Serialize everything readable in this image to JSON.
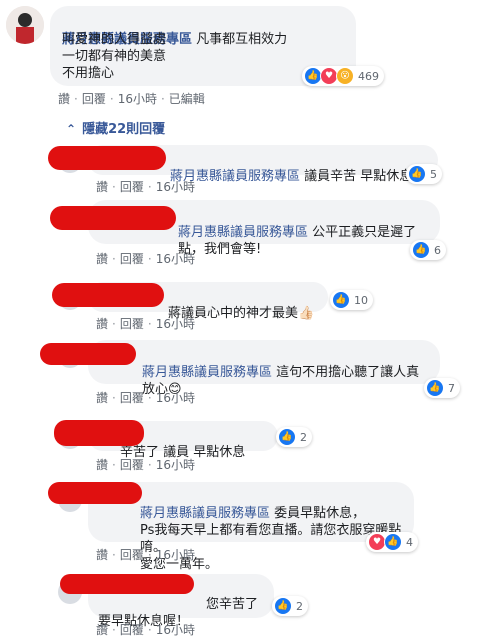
{
  "top_comment": {
    "author": "蔣月惠縣議員服務專區",
    "line1_rest": " 凡事都互相效力",
    "line2": "叫愛神的人得益處",
    "line3": "一切都有神的美意",
    "line4": "不用擔心",
    "reaction_count": "469",
    "actions": {
      "like": "讚",
      "reply": "回覆",
      "time": "16小時",
      "edited": "已編輯"
    }
  },
  "hidden_replies": {
    "arrow": "⌃",
    "label": "隱藏22則回覆"
  },
  "replies": [
    {
      "mention": "蔣月惠縣議員服務專區",
      "text": " 議員辛苦 早點休息",
      "reactions": "5",
      "like": "讚",
      "reply": "回覆",
      "time": "16小時"
    },
    {
      "mention": "蔣月惠縣議員服務專區",
      "text": " 公平正義只是遲了\n點，我們會等!",
      "reactions": "6",
      "like": "讚",
      "reply": "回覆",
      "time": "16小時"
    },
    {
      "mention": "",
      "text": "蔣議員心中的神才最美👍🏻",
      "reactions": "10",
      "like": "讚",
      "reply": "回覆",
      "time": "16小時"
    },
    {
      "mention": "蔣月惠縣議員服務專區",
      "text": " 這句不用擔心聽了讓人真\n放心😊",
      "reactions": "7",
      "like": "讚",
      "reply": "回覆",
      "time": "16小時"
    },
    {
      "mention": "",
      "text": "辛苦了 議員 早點休息",
      "reactions": "2",
      "like": "讚",
      "reply": "回覆",
      "time": "16小時"
    },
    {
      "mention": "蔣月惠縣議員服務專區",
      "text": " 委員早點休息，\nPs我每天早上都有看您直播。請您衣服穿暖點唷。\n愛您一萬年。",
      "reactions": "4",
      "like": "讚",
      "reply": "回覆",
      "time": "16小時"
    },
    {
      "mention": "",
      "text": "您辛苦了\n要早點休息喔！",
      "reactions": "2",
      "like": "讚",
      "reply": "回覆",
      "time": "16小時"
    }
  ],
  "colors": {
    "link": "#385898",
    "bubble": "#f2f3f5",
    "redaction": "#e01010",
    "like": "#1877f2",
    "love": "#f33e58",
    "wow": "#f7b125"
  },
  "icons": {
    "like": "thumbs-up-icon",
    "love": "heart-icon",
    "wow": "wow-icon"
  }
}
